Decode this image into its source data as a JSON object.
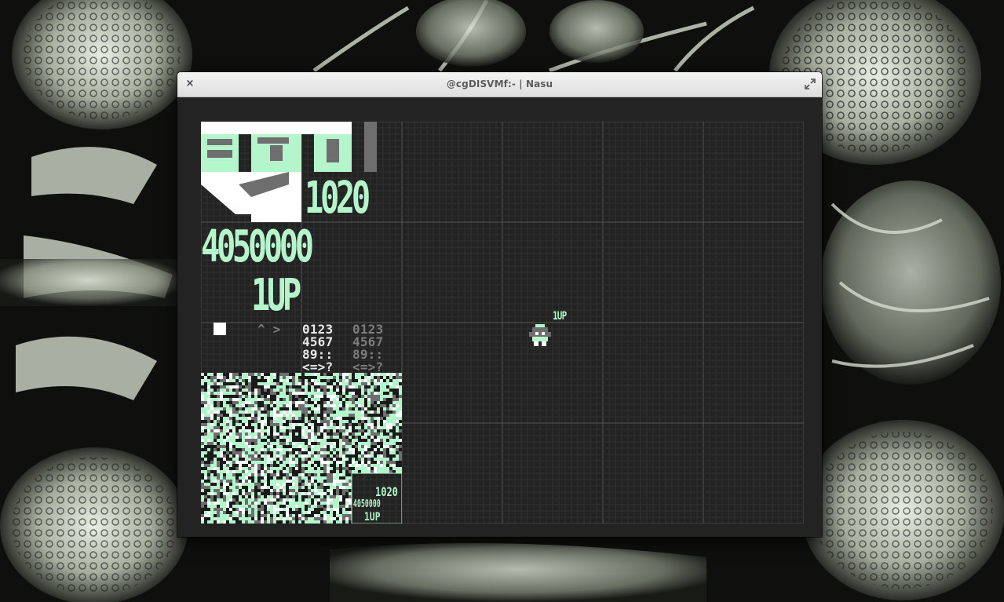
{
  "window": {
    "title": "@cgDISVMf:- | Nasu",
    "close_symbol": "×"
  },
  "tilesheet": {
    "big_digits_row1": "1020",
    "big_digits_row2": "4050000",
    "big_label": "1UP",
    "arrows": "^ >",
    "font_white": [
      "0123",
      "4567",
      "89::",
      "<=>?"
    ],
    "font_grey": [
      "0123",
      "4567",
      "89::",
      "<=>?"
    ],
    "mini_digits_row1": "1020",
    "mini_digits_row2": "4050000",
    "mini_label": "1UP"
  },
  "canvas": {
    "sprite_label": "1UP"
  },
  "colors": {
    "tile_green": "#b5f5cc",
    "tile_white": "#ffffff",
    "tile_grey": "#6e6e6e",
    "canvas_bg": "#232323",
    "grid_line": "#303030",
    "grid_major": "#555555"
  }
}
